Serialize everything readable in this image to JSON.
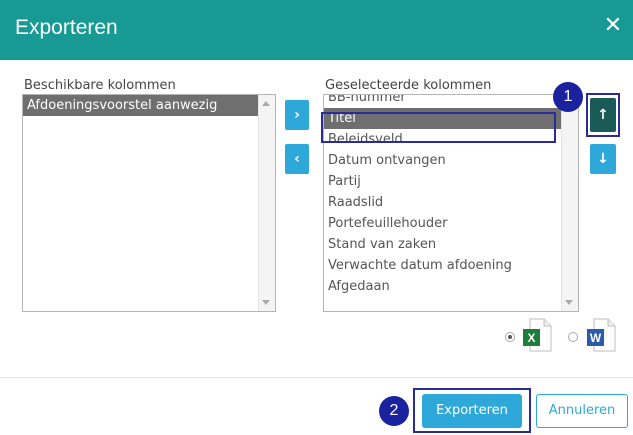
{
  "dialog": {
    "title": "Exporteren",
    "close_glyph": "✕"
  },
  "available": {
    "label": "Beschikbare kolommen",
    "items": [
      "Afdoeningsvoorstel aanwezig"
    ]
  },
  "selected": {
    "label": "Geselecteerde kolommen",
    "items": [
      "BB-nummer",
      "Titel",
      "Beleidsveld",
      "Datum ontvangen",
      "Partij",
      "Raadslid",
      "Portefeuillehouder",
      "Stand van zaken",
      "Verwachte datum afdoening",
      "Afgedaan"
    ]
  },
  "transfer": {
    "move_right_glyph": "›",
    "move_left_glyph": "‹"
  },
  "order": {
    "move_up_glyph": "↑",
    "move_down_glyph": "↓"
  },
  "annotations": {
    "badge1": "1",
    "badge2": "2"
  },
  "format": {
    "excel_letter": "X",
    "word_letter": "W",
    "selected": "excel"
  },
  "footer": {
    "export_label": "Exporteren",
    "cancel_label": "Annuleren"
  },
  "colors": {
    "header": "#169a93",
    "accent": "#2ea8d8",
    "badge": "#1b22a0"
  }
}
